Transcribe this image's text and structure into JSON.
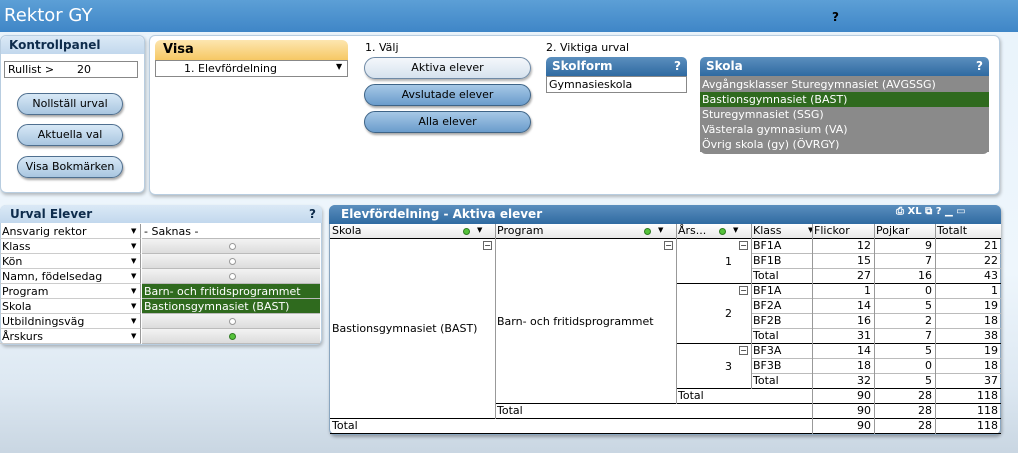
{
  "app": {
    "title": "Rektor GY",
    "help": "?"
  },
  "kontrollpanel": {
    "title": "Kontrollpanel",
    "rullist_label": "Rullist >",
    "rullist_value": "20",
    "buttons": [
      "Nollställ urval",
      "Aktuella val",
      "Visa Bokmärken"
    ]
  },
  "visa": {
    "title": "Visa",
    "selected": "1. Elevfördelning",
    "step1": "1. Välj",
    "step2": "2. Viktiga urval",
    "buttons": [
      "Aktiva elever",
      "Avslutade elever",
      "Alla elever"
    ]
  },
  "skolform": {
    "title": "Skolform",
    "help": "?",
    "items": [
      "Gymnasieskola"
    ]
  },
  "skola": {
    "title": "Skola",
    "help": "?",
    "items": [
      "Avgångsklasser Sturegymnasiet (AVGSSG)",
      "Bastionsgymnasiet (BAST)",
      "Sturegymnasiet (SSG)",
      "Västerala gymnasium (VA)",
      "Övrig skola (gy) (ÖVRGY)"
    ],
    "selected_index": 1
  },
  "urval": {
    "title": "Urval Elever",
    "help": "?",
    "rows": [
      {
        "label": "Ansvarig rektor",
        "value": "- Saknas -",
        "state": "text"
      },
      {
        "label": "Klass",
        "value": "",
        "state": "empty"
      },
      {
        "label": "Kön",
        "value": "",
        "state": "empty"
      },
      {
        "label": "Namn, födelsedag",
        "value": "",
        "state": "empty"
      },
      {
        "label": "Program",
        "value": "Barn- och fritidsprogrammet",
        "state": "selected"
      },
      {
        "label": "Skola",
        "value": "Bastionsgymnasiet (BAST)",
        "state": "selected"
      },
      {
        "label": "Utbildningsväg",
        "value": "",
        "state": "empty"
      },
      {
        "label": "Årskurs",
        "value": "",
        "state": "green"
      }
    ]
  },
  "table": {
    "title": "Elevfördelning - Aktiva elever",
    "tools": [
      "XL",
      "?"
    ],
    "headers": {
      "skola": "Skola",
      "program": "Program",
      "arskurs": "Års...",
      "klass": "Klass",
      "flickor": "Flickor",
      "pojkar": "Pojkar",
      "totalt": "Totalt"
    },
    "skola": "Bastionsgymnasiet (BAST)",
    "program": "Barn- och fritidsprogrammet",
    "groups": [
      {
        "year": "1",
        "rows": [
          [
            "BF1A",
            "12",
            "9",
            "21"
          ],
          [
            "BF1B",
            "15",
            "7",
            "22"
          ]
        ],
        "total": [
          "Total",
          "27",
          "16",
          "43"
        ]
      },
      {
        "year": "2",
        "rows": [
          [
            "BF1A",
            "1",
            "0",
            "1"
          ],
          [
            "BF2A",
            "14",
            "5",
            "19"
          ],
          [
            "BF2B",
            "16",
            "2",
            "18"
          ]
        ],
        "total": [
          "Total",
          "31",
          "7",
          "38"
        ]
      },
      {
        "year": "3",
        "rows": [
          [
            "BF3A",
            "14",
            "5",
            "19"
          ],
          [
            "BF3B",
            "18",
            "0",
            "18"
          ]
        ],
        "total": [
          "Total",
          "32",
          "5",
          "37"
        ]
      }
    ],
    "year_total": [
      "Total",
      "90",
      "28",
      "118"
    ],
    "program_total": [
      "Total",
      "90",
      "28",
      "118"
    ],
    "grand_total": [
      "Total",
      "90",
      "28",
      "118"
    ]
  }
}
